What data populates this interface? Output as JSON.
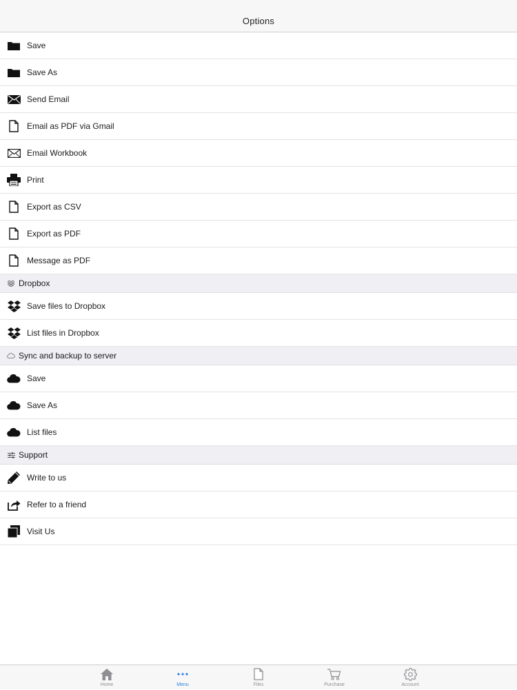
{
  "navbar": {
    "title": "Options"
  },
  "main_items": [
    {
      "label": "Save",
      "icon": "folder-icon"
    },
    {
      "label": "Save As",
      "icon": "folder-icon"
    },
    {
      "label": "Send Email",
      "icon": "envelope-filled-icon"
    },
    {
      "label": "Email as PDF via Gmail",
      "icon": "document-icon"
    },
    {
      "label": "Email Workbook",
      "icon": "envelope-outline-icon"
    },
    {
      "label": "Print",
      "icon": "printer-icon"
    },
    {
      "label": "Export as CSV",
      "icon": "document-icon"
    },
    {
      "label": "Export as PDF",
      "icon": "document-icon"
    },
    {
      "label": "Message as PDF",
      "icon": "document-icon"
    }
  ],
  "dropbox": {
    "header": "Dropbox",
    "items": [
      {
        "label": "Save files to Dropbox",
        "icon": "dropbox-icon"
      },
      {
        "label": "List files in Dropbox",
        "icon": "dropbox-icon"
      }
    ]
  },
  "sync": {
    "header": "Sync and backup to server",
    "items": [
      {
        "label": "Save",
        "icon": "cloud-icon"
      },
      {
        "label": "Save As",
        "icon": "cloud-icon"
      },
      {
        "label": "List files",
        "icon": "cloud-icon"
      }
    ]
  },
  "support": {
    "header": "Support",
    "items": [
      {
        "label": "Write to us",
        "icon": "pencil-icon"
      },
      {
        "label": "Refer to a friend",
        "icon": "share-icon"
      },
      {
        "label": "Visit Us",
        "icon": "window-stack-icon"
      }
    ]
  },
  "tabbar": {
    "tabs": [
      {
        "label": "Home",
        "icon": "home-icon",
        "active": false
      },
      {
        "label": "Menu",
        "icon": "ellipsis-icon",
        "active": true
      },
      {
        "label": "Files",
        "icon": "file-icon",
        "active": false
      },
      {
        "label": "Purchase",
        "icon": "cart-icon",
        "active": false
      },
      {
        "label": "Account",
        "icon": "gear-icon",
        "active": false
      }
    ]
  },
  "colors": {
    "accent": "#2f7fe0",
    "section_bg": "#efeff4",
    "tab_inactive": "#8e8e93"
  }
}
